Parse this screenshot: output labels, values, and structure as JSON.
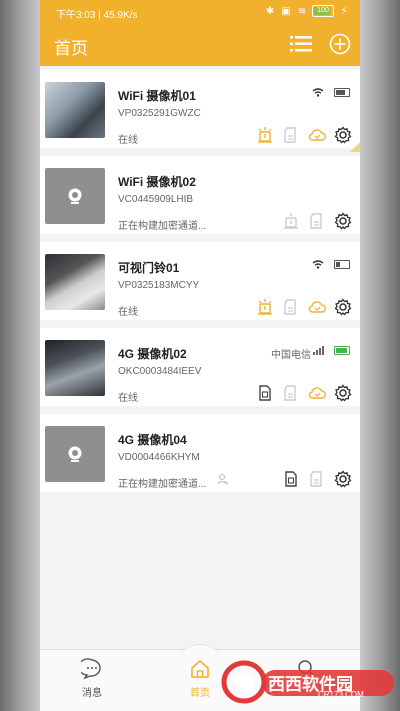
{
  "statusbar": {
    "time_speed": "下午3:03 | 45.9K/s",
    "battery_text": "100",
    "bluetooth_icon": "bluetooth-icon",
    "wifi_icon": "wifi-icon",
    "charge_icon": "charging-icon"
  },
  "header": {
    "title": "首页",
    "list_icon": "list-icon",
    "add_icon": "add-icon",
    "accent": "#f2b12d"
  },
  "devices": [
    {
      "name": "WiFi 摄像机01",
      "serial": "VP0325291GWZC",
      "status": "在线",
      "thumb": "photo"
    },
    {
      "name": "WiFi 摄像机02",
      "serial": "VC0445909LHIB",
      "status": "正在构建加密通道...",
      "thumb": "placeholder"
    },
    {
      "name": "可视门铃01",
      "serial": "VP0325183MCYY",
      "status": "在线",
      "thumb": "photo"
    },
    {
      "name": "4G 摄像机02",
      "serial": "OKC0003484IEEV",
      "status": "在线",
      "carrier": "中国电信",
      "thumb": "photo"
    },
    {
      "name": "4G 摄像机04",
      "serial": "VD0004466KHYM",
      "status": "正在构建加密通道...",
      "thumb": "placeholder"
    }
  ],
  "tabs": [
    {
      "label": "消息",
      "icon": "message-icon"
    },
    {
      "label": "首页",
      "icon": "home-icon"
    },
    {
      "label": "",
      "icon": "search-icon"
    }
  ],
  "watermark": {
    "text": "西西软件园",
    "sub": "CR173.COM"
  }
}
